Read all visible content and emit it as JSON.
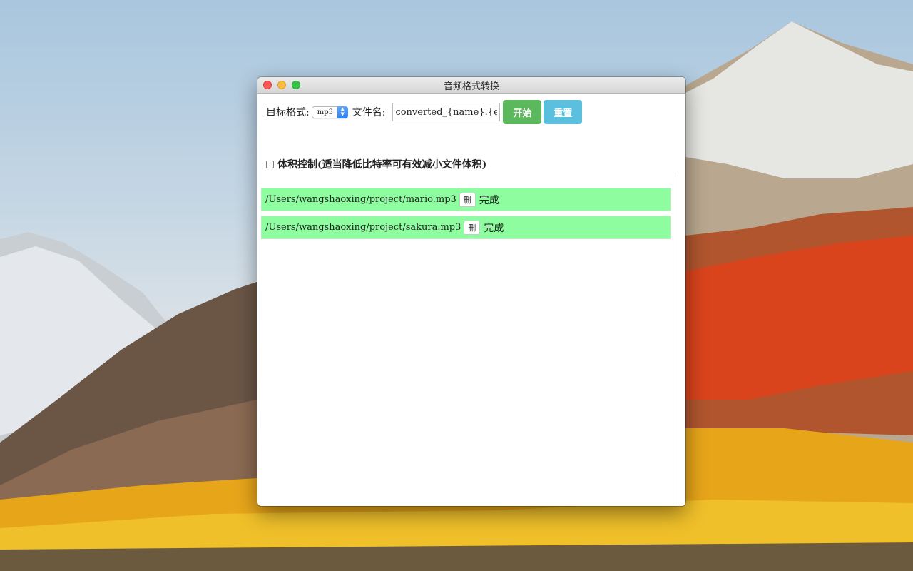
{
  "window": {
    "title": "音频格式转换"
  },
  "toolbar": {
    "format_label": "目标格式:",
    "format_value": "mp3",
    "filename_label": "文件名:",
    "filename_value": "converted_{name}.{ext}",
    "start_label": "开始",
    "reset_label": "重置"
  },
  "size_control": {
    "label": "体积控制(适当降低比特率可有效减小文件体积)",
    "checked": false
  },
  "files": [
    {
      "path": "/Users/wangshaoxing/project/mario.mp3",
      "delete_label": "删",
      "status": "完成"
    },
    {
      "path": "/Users/wangshaoxing/project/sakura.mp3",
      "delete_label": "删",
      "status": "完成"
    }
  ],
  "colors": {
    "start_button": "#5cb85c",
    "reset_button": "#5bc0de",
    "row_done_bg": "#8dfd9f"
  }
}
